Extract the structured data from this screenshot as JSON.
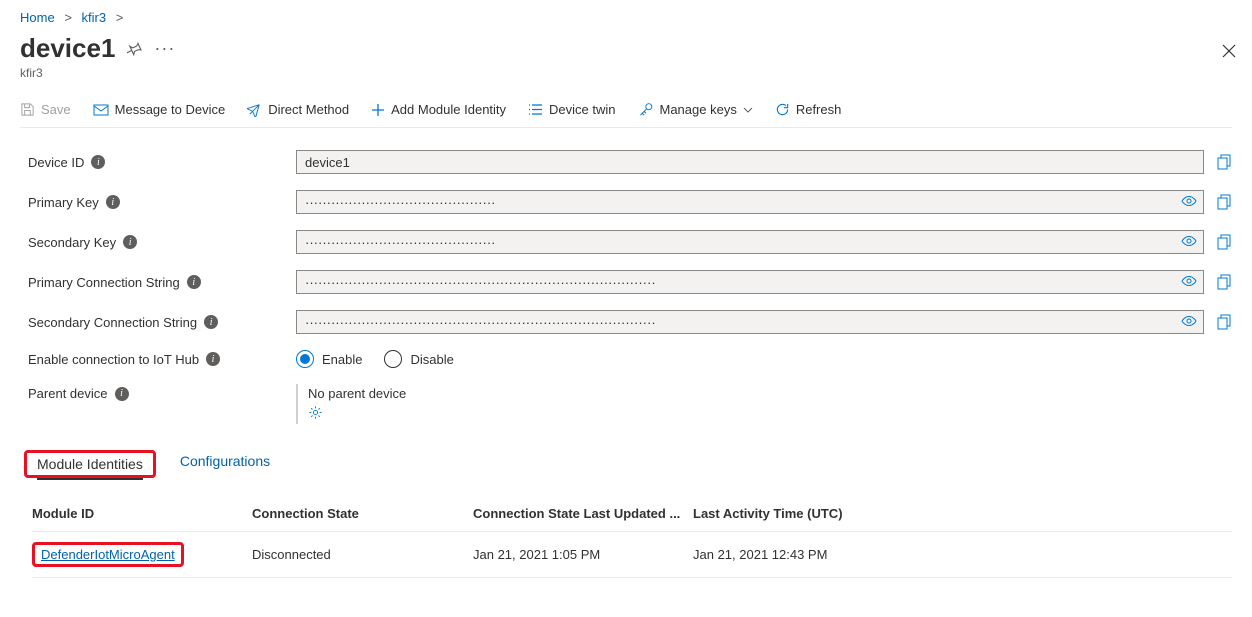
{
  "breadcrumb": {
    "home": "Home",
    "parent": "kfir3"
  },
  "page": {
    "title": "device1",
    "subtitle": "kfir3"
  },
  "toolbar": {
    "save": "Save",
    "message": "Message to Device",
    "direct": "Direct Method",
    "addModule": "Add Module Identity",
    "twin": "Device twin",
    "manageKeys": "Manage keys",
    "refresh": "Refresh"
  },
  "fields": {
    "deviceId": {
      "label": "Device ID",
      "value": "device1"
    },
    "primaryKey": {
      "label": "Primary Key",
      "value": "············································"
    },
    "secondaryKey": {
      "label": "Secondary Key",
      "value": "············································"
    },
    "primaryConn": {
      "label": "Primary Connection String",
      "value": "·················································································"
    },
    "secondaryConn": {
      "label": "Secondary Connection String",
      "value": "·················································································"
    },
    "enableConn": {
      "label": "Enable connection to IoT Hub",
      "enable": "Enable",
      "disable": "Disable"
    },
    "parent": {
      "label": "Parent device",
      "none": "No parent device"
    }
  },
  "tabs": {
    "modules": "Module Identities",
    "configs": "Configurations"
  },
  "table": {
    "headers": {
      "id": "Module ID",
      "state": "Connection State",
      "updated": "Connection State Last Updated ...",
      "activity": "Last Activity Time (UTC)"
    },
    "rows": [
      {
        "id": "DefenderIotMicroAgent",
        "state": "Disconnected",
        "updated": "Jan 21, 2021 1:05 PM",
        "activity": "Jan 21, 2021 12:43 PM"
      }
    ]
  }
}
